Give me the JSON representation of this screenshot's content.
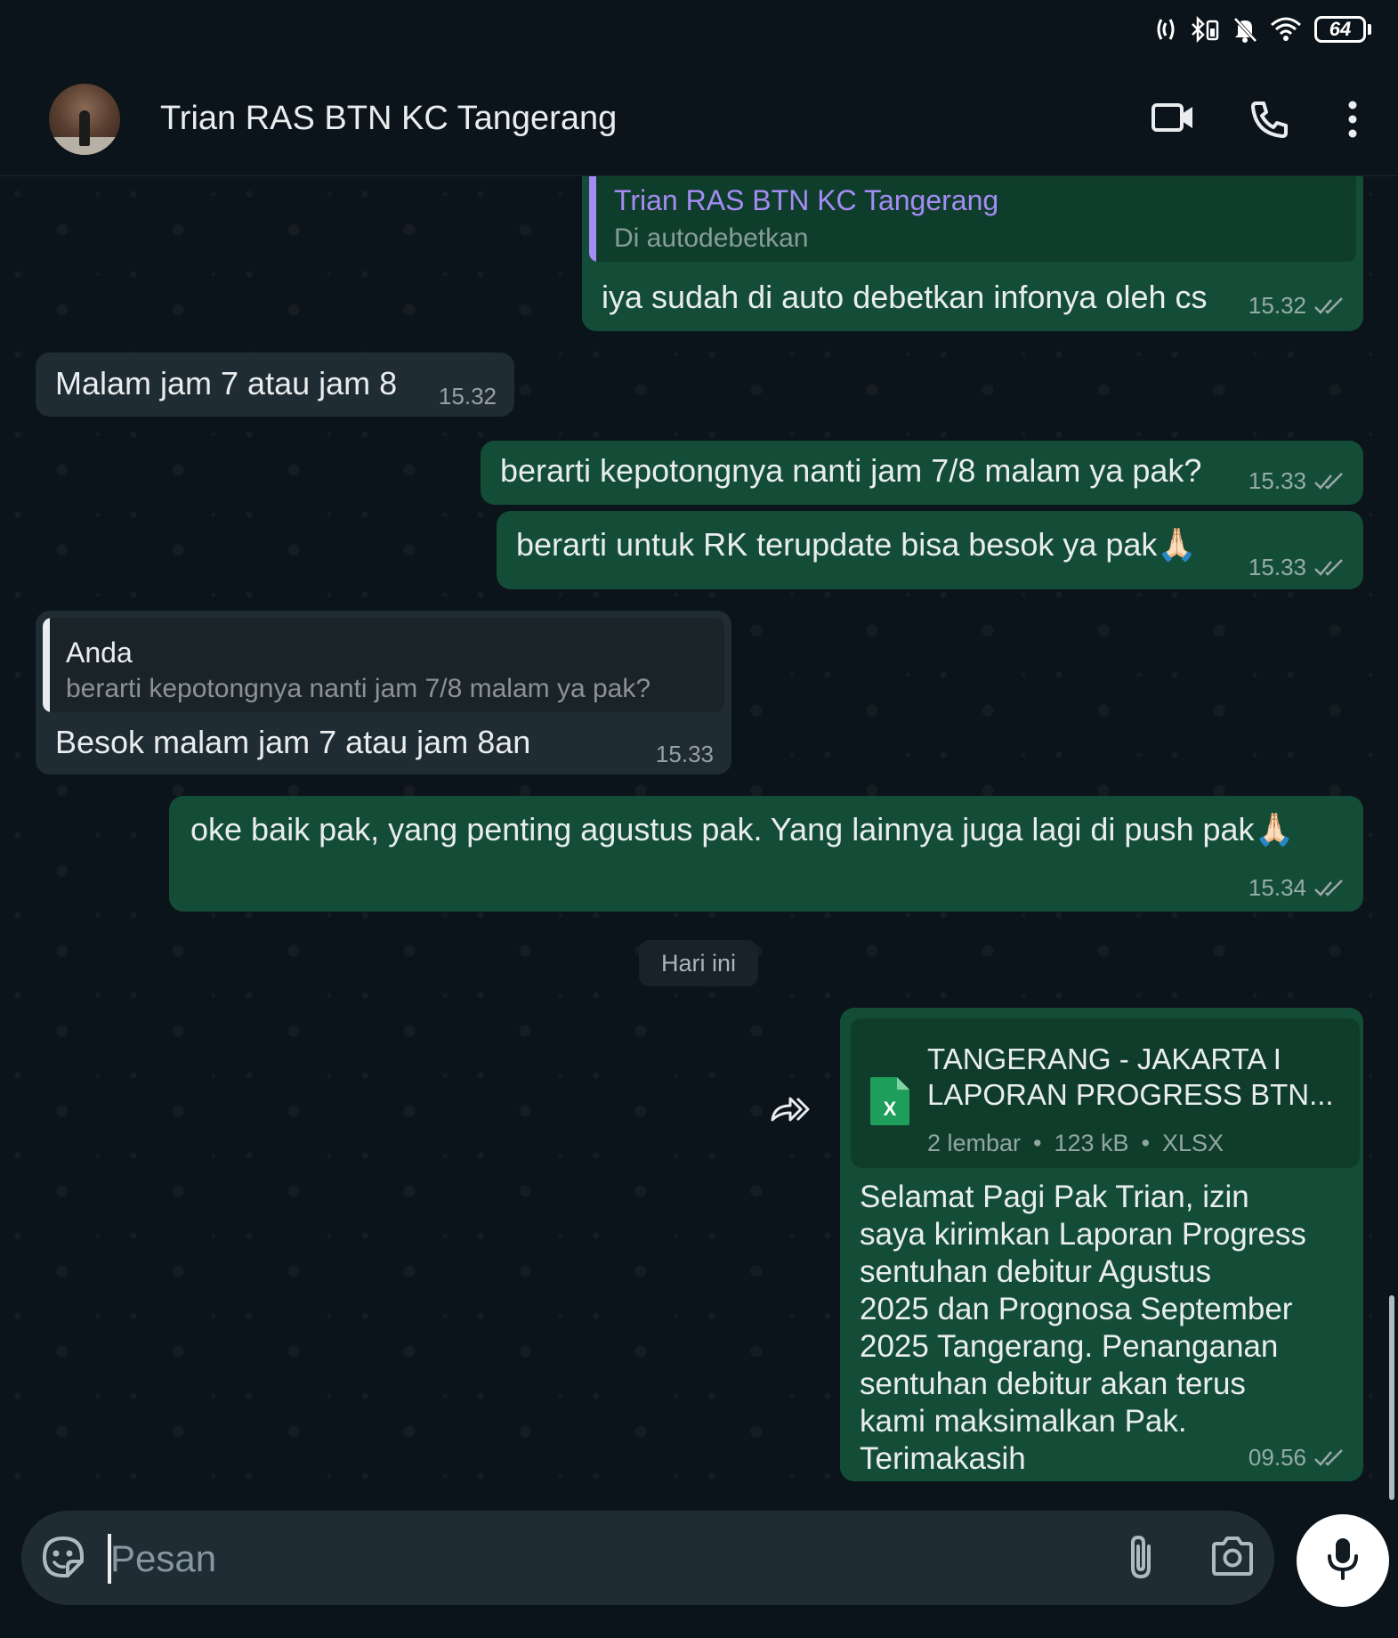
{
  "status_bar": {
    "battery": "64"
  },
  "header": {
    "contact_name": "Trian RAS BTN KC Tangerang"
  },
  "messages": [
    {
      "direction": "out",
      "quote_name": "Trian RAS BTN KC Tangerang",
      "quote_text": "Di autodebetkan",
      "text": "iya sudah di auto debetkan infonya oleh cs",
      "time": "15.32"
    },
    {
      "direction": "in",
      "text": "Malam jam 7 atau jam 8",
      "time": "15.32"
    },
    {
      "direction": "out",
      "text": "berarti kepotongnya nanti jam 7/8 malam ya pak?",
      "time": "15.33"
    },
    {
      "direction": "out",
      "text": "berarti untuk RK terupdate bisa besok ya pak🙏🏻",
      "time": "15.33"
    },
    {
      "direction": "in",
      "quote_name": "Anda",
      "quote_text": "berarti kepotongnya nanti jam 7/8 malam ya pak?",
      "text": "Besok malam jam 7 atau jam 8an",
      "time": "15.33"
    },
    {
      "direction": "out",
      "text": "oke baik pak, yang penting agustus pak. Yang lainnya juga lagi di push pak🙏🏻",
      "time": "15.34"
    },
    {
      "direction": "out",
      "document": {
        "title_line1": "TANGERANG - JAKARTA I",
        "title_line2": "LAPORAN PROGRESS BTN...",
        "pages": "2 lembar",
        "size": "123 kB",
        "type": "XLSX",
        "icon": "xlsx-icon"
      },
      "caption_lines": [
        "Selamat Pagi Pak Trian, izin",
        "saya kirimkan Laporan Progress",
        "sentuhan debitur Agustus",
        "2025 dan Prognosa September",
        "2025 Tangerang. Penanganan",
        "sentuhan debitur akan terus",
        "kami maksimalkan Pak.",
        "Terimakasih"
      ],
      "time": "09.56"
    }
  ],
  "date_divider": "Hari ini",
  "input": {
    "placeholder": "Pesan"
  },
  "colors": {
    "background": "#0b141a",
    "outgoing_bubble": "#144d37",
    "incoming_bubble": "#202c33",
    "accent_purple": "#a58cf4",
    "tick_gray": "#9aa6ab"
  }
}
